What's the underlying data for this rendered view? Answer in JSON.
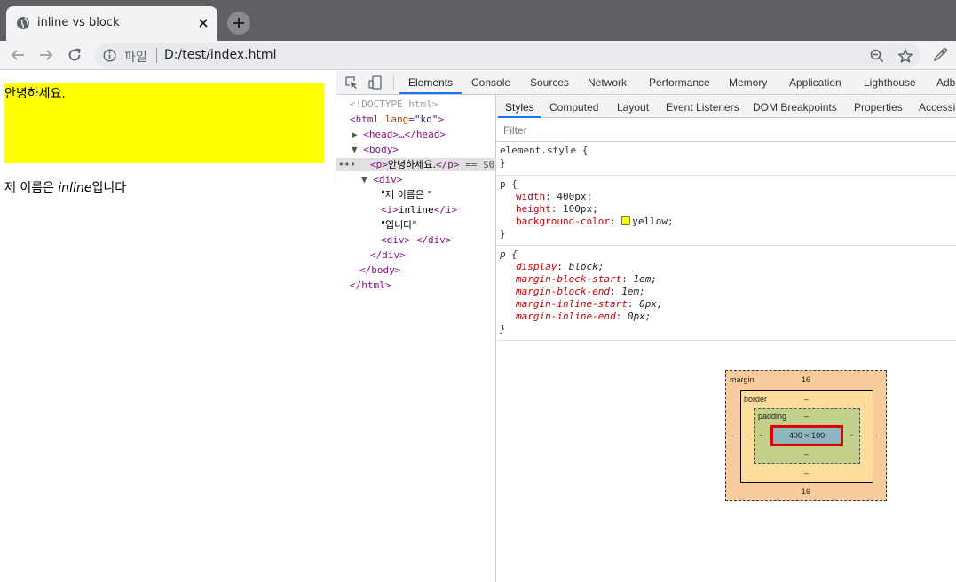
{
  "browser": {
    "tab_title": "inline vs block",
    "omnibox_scheme": "파일",
    "url": "D:/test/index.html"
  },
  "page": {
    "paragraph_text": "안녕하세요.",
    "line_prefix": "제 이름은 ",
    "line_italic": "inline",
    "line_suffix": "입니다",
    "paragraph_bg": "#ffff00"
  },
  "devtools": {
    "tabs": [
      "Elements",
      "Console",
      "Sources",
      "Network",
      "Performance",
      "Memory",
      "Application",
      "Lighthouse",
      "Adb"
    ],
    "active_tab": "Elements",
    "styles_tabs": [
      "Styles",
      "Computed",
      "Layout",
      "Event Listeners",
      "DOM Breakpoints",
      "Properties",
      "Accessib"
    ],
    "filter_placeholder": "Filter",
    "dom_tree": {
      "doctype": "<!DOCTYPE html>",
      "html_open": "<html lang=\"ko\">",
      "head": "<head>…</head>",
      "body_open": "<body>",
      "p_text": "안녕하세요.",
      "p_suffix": "== $0",
      "div_open": "<div>",
      "text1": "\"제 이름은 \"",
      "i_text": "inline",
      "text2": "\"입니다\"",
      "inner_div": "<div> </div>",
      "div_close": "</div>",
      "body_close": "</body>",
      "html_close": "</html>",
      "ellipsis": "•••"
    },
    "rules": {
      "element_style_selector": "element.style {",
      "close_brace": "}",
      "author_selector": "p {",
      "author_props": [
        {
          "name": "width",
          "value": "400px;"
        },
        {
          "name": "height",
          "value": "100px;"
        },
        {
          "name": "background-color",
          "value": "yellow;"
        }
      ],
      "ua_selector": "p {",
      "ua_props": [
        {
          "name": "display",
          "value": "block;"
        },
        {
          "name": "margin-block-start",
          "value": "1em;"
        },
        {
          "name": "margin-block-end",
          "value": "1em;"
        },
        {
          "name": "margin-inline-start",
          "value": "0px;"
        },
        {
          "name": "margin-inline-end",
          "value": "0px;"
        }
      ]
    },
    "box_model": {
      "margin_label": "margin",
      "margin_top": "16",
      "margin_bottom": "16",
      "margin_left": "-",
      "margin_right": "-",
      "border_label": "border",
      "border_top": "–",
      "border_bottom": "–",
      "border_left": "-",
      "border_right": "-",
      "padding_label": "padding",
      "padding_top": "–",
      "padding_bottom": "–",
      "padding_left": "-",
      "padding_right": "-",
      "content_size": "400 × 100"
    }
  }
}
